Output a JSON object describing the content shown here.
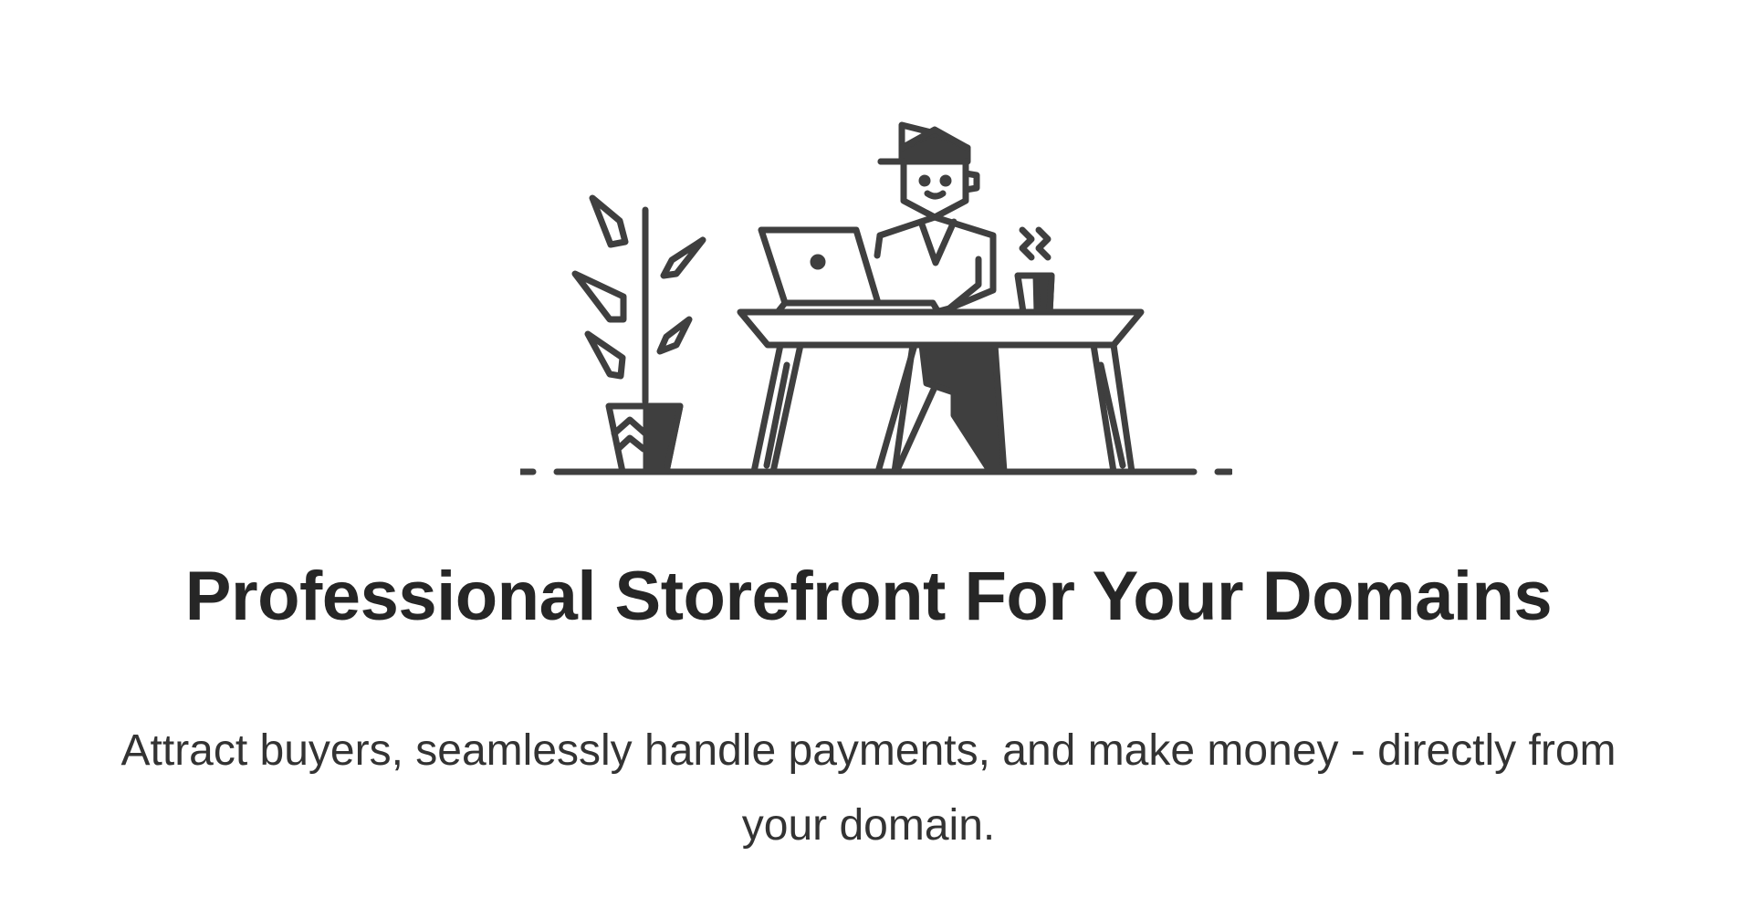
{
  "hero": {
    "headline": "Professional Storefront For Your Domains",
    "subtext": "Attract buyers, seamlessly handle payments, and make money - directly from your domain."
  },
  "illustration": {
    "stroke_color": "#3f3f3f",
    "fill_color": "#3f3f3f",
    "subject": "person-working-at-desk-illustration"
  }
}
